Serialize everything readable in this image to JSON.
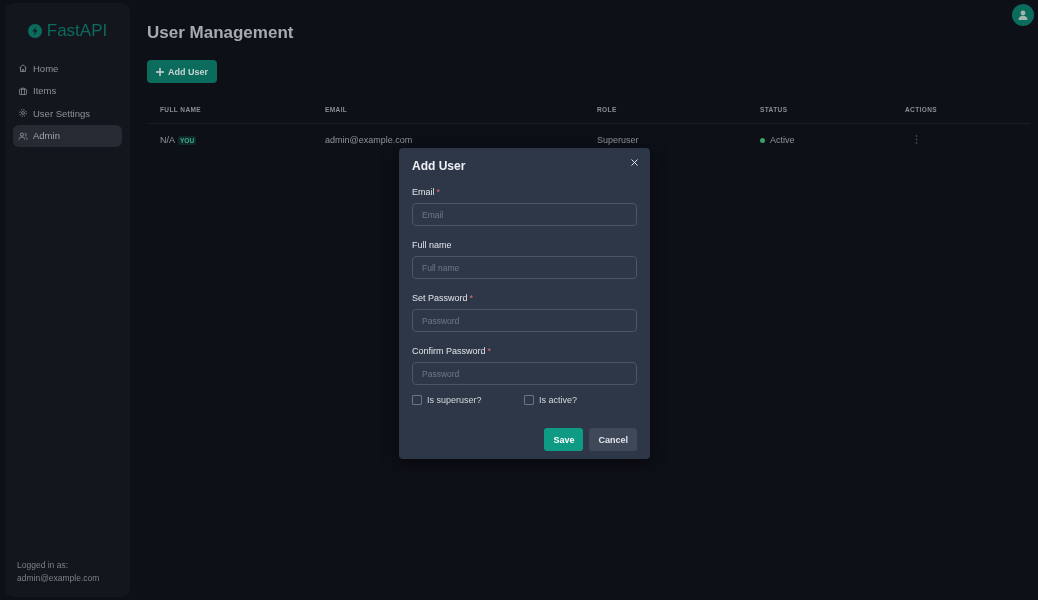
{
  "sidebar": {
    "logo": "FastAPI",
    "items": [
      {
        "label": "Home",
        "selected": false
      },
      {
        "label": "Items",
        "selected": false
      },
      {
        "label": "User Settings",
        "selected": false
      },
      {
        "label": "Admin",
        "selected": true
      }
    ],
    "footer_label": "Logged in as:",
    "footer_email": "admin@example.com"
  },
  "page": {
    "title": "User Management",
    "add_button": "Add User"
  },
  "table": {
    "columns": [
      "FULL NAME",
      "EMAIL",
      "ROLE",
      "STATUS",
      "ACTIONS"
    ],
    "rows": [
      {
        "full_name": "N/A",
        "badge": "YOU",
        "email": "admin@example.com",
        "role": "Superuser",
        "status": "Active",
        "color": "#38a169"
      }
    ]
  },
  "dialog": {
    "title": "Add User",
    "fields": [
      {
        "label": "Email",
        "required_mark": "*",
        "placeholder": "Email"
      },
      {
        "label": "Full name",
        "placeholder": "Full name"
      },
      {
        "label": "Set Password",
        "required_mark": "*",
        "placeholder": "Password"
      },
      {
        "label": "Confirm Password",
        "required_mark": "*",
        "placeholder": "Password"
      }
    ],
    "checkboxes": [
      {
        "label": "Is superuser?",
        "checked": false
      },
      {
        "label": "Is active?",
        "checked": false
      }
    ],
    "buttons": [
      {
        "label": "Save",
        "kind": "primary"
      },
      {
        "label": "Cancel",
        "kind": "secondary"
      }
    ]
  }
}
